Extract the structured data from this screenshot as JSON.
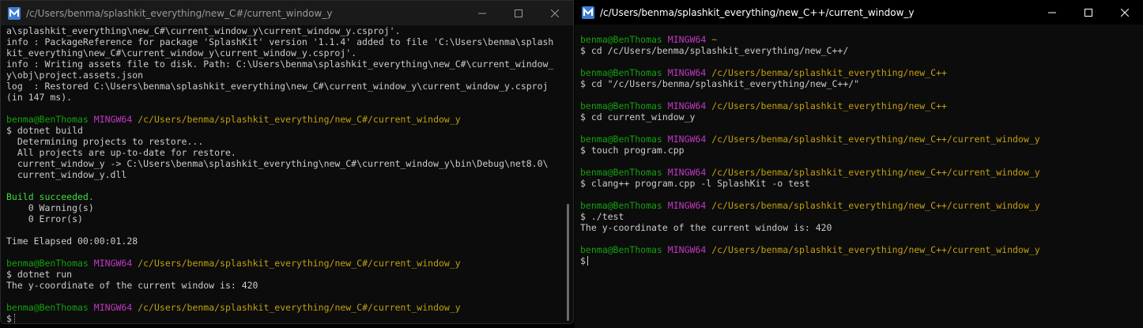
{
  "left_window": {
    "title": "/c/Users/benma/splashkit_everything/new_C#/current_window_y",
    "lines": [
      {
        "t": "plain",
        "text": "a\\splashkit_everything\\new_C#\\current_window_y\\current_window_y.csproj'."
      },
      {
        "t": "plain",
        "text": "info : PackageReference for package 'SplashKit' version '1.1.4' added to file 'C:\\Users\\benma\\splash"
      },
      {
        "t": "plain",
        "text": "kit_everything\\new_C#\\current_window_y\\current_window_y.csproj'."
      },
      {
        "t": "plain",
        "text": "info : Writing assets file to disk. Path: C:\\Users\\benma\\splashkit_everything\\new_C#\\current_window_"
      },
      {
        "t": "plain",
        "text": "y\\obj\\project.assets.json"
      },
      {
        "t": "plain",
        "text": "log  : Restored C:\\Users\\benma\\splashkit_everything\\new_C#\\current_window_y\\current_window_y.csproj"
      },
      {
        "t": "plain",
        "text": "(in 147 ms)."
      },
      {
        "t": "blank",
        "text": ""
      },
      {
        "t": "prompt",
        "user": "benma@BenThomas",
        "host": "MINGW64",
        "path": "/c/Users/benma/splashkit_everything/new_C#/current_window_y"
      },
      {
        "t": "plain",
        "text": "$ dotnet build"
      },
      {
        "t": "plain",
        "text": "  Determining projects to restore..."
      },
      {
        "t": "plain",
        "text": "  All projects are up-to-date for restore."
      },
      {
        "t": "plain",
        "text": "  current_window_y -> C:\\Users\\benma\\splashkit_everything\\new_C#\\current_window_y\\bin\\Debug\\net8.0\\"
      },
      {
        "t": "plain",
        "text": "  current_window_y.dll"
      },
      {
        "t": "blank",
        "text": ""
      },
      {
        "t": "green",
        "text": "Build succeeded."
      },
      {
        "t": "plain",
        "text": "    0 Warning(s)"
      },
      {
        "t": "plain",
        "text": "    0 Error(s)"
      },
      {
        "t": "blank",
        "text": ""
      },
      {
        "t": "plain",
        "text": "Time Elapsed 00:00:01.28"
      },
      {
        "t": "blank",
        "text": ""
      },
      {
        "t": "prompt",
        "user": "benma@BenThomas",
        "host": "MINGW64",
        "path": "/c/Users/benma/splashkit_everything/new_C#/current_window_y"
      },
      {
        "t": "plain",
        "text": "$ dotnet run"
      },
      {
        "t": "plain",
        "text": "The y-coordinate of the current window is: 420"
      },
      {
        "t": "blank",
        "text": ""
      },
      {
        "t": "prompt",
        "user": "benma@BenThomas",
        "host": "MINGW64",
        "path": "/c/Users/benma/splashkit_everything/new_C#/current_window_y"
      },
      {
        "t": "cursor",
        "text": "$"
      }
    ]
  },
  "right_window": {
    "title": "/c/Users/benma/splashkit_everything/new_C++/current_window_y",
    "lines": [
      {
        "t": "prompt",
        "user": "benma@BenThomas",
        "host": "MINGW64",
        "path": "~"
      },
      {
        "t": "plain",
        "text": "$ cd /c/Users/benma/splashkit_everything/new_C++/"
      },
      {
        "t": "blank",
        "text": ""
      },
      {
        "t": "prompt",
        "user": "benma@BenThomas",
        "host": "MINGW64",
        "path": "/c/Users/benma/splashkit_everything/new_C++"
      },
      {
        "t": "plain",
        "text": "$ cd \"/c/Users/benma/splashkit_everything/new_C++/\""
      },
      {
        "t": "blank",
        "text": ""
      },
      {
        "t": "prompt",
        "user": "benma@BenThomas",
        "host": "MINGW64",
        "path": "/c/Users/benma/splashkit_everything/new_C++"
      },
      {
        "t": "plain",
        "text": "$ cd current_window_y"
      },
      {
        "t": "blank",
        "text": ""
      },
      {
        "t": "prompt",
        "user": "benma@BenThomas",
        "host": "MINGW64",
        "path": "/c/Users/benma/splashkit_everything/new_C++/current_window_y"
      },
      {
        "t": "plain",
        "text": "$ touch program.cpp"
      },
      {
        "t": "blank",
        "text": ""
      },
      {
        "t": "prompt",
        "user": "benma@BenThomas",
        "host": "MINGW64",
        "path": "/c/Users/benma/splashkit_everything/new_C++/current_window_y"
      },
      {
        "t": "plain",
        "text": "$ clang++ program.cpp -l SplashKit -o test"
      },
      {
        "t": "blank",
        "text": ""
      },
      {
        "t": "prompt",
        "user": "benma@BenThomas",
        "host": "MINGW64",
        "path": "/c/Users/benma/splashkit_everything/new_C++/current_window_y"
      },
      {
        "t": "plain",
        "text": "$ ./test"
      },
      {
        "t": "plain",
        "text": "The y-coordinate of the current window is: 420"
      },
      {
        "t": "blank",
        "text": ""
      },
      {
        "t": "prompt",
        "user": "benma@BenThomas",
        "host": "MINGW64",
        "path": "/c/Users/benma/splashkit_everything/new_C++/current_window_y"
      },
      {
        "t": "cursor",
        "text": "$"
      }
    ]
  },
  "icons": {
    "app": "msys2-m-icon",
    "minimize": "minimize-icon",
    "maximize": "maximize-icon",
    "close": "close-icon"
  },
  "colors": {
    "user": "#13a10e",
    "mingw": "#c239c2",
    "path": "#c1a00e",
    "success": "#3fdc3f",
    "text": "#cccccc"
  }
}
